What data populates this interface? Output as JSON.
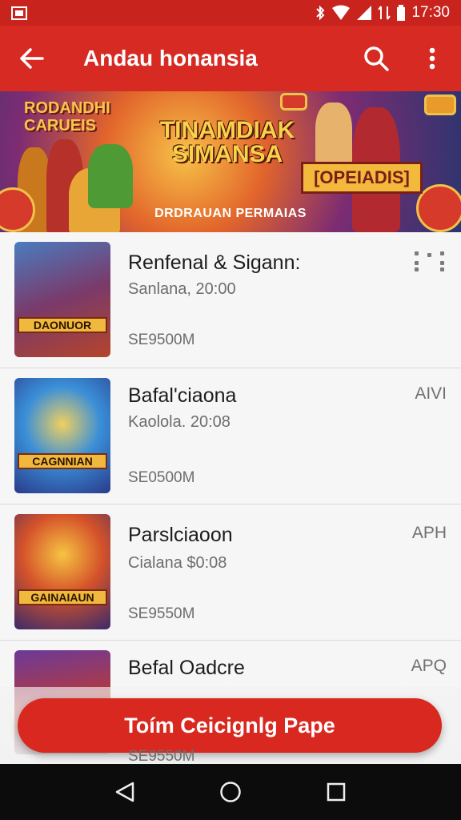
{
  "status_bar": {
    "time": "17:30",
    "icons": [
      "notification-icon",
      "bluetooth-icon",
      "wifi-icon",
      "signal-icon",
      "data-icon",
      "battery-icon"
    ]
  },
  "app_bar": {
    "title": "Andau honansia",
    "icons": [
      "arrow-back-icon",
      "search-icon",
      "more-vert-icon"
    ]
  },
  "banner": {
    "left_text": "RODANDHI CARUEIS",
    "title_line1": "TINAMDIAK",
    "title_line2": "SIMANSA",
    "right_text": "[OPEIADIS]",
    "subtitle": "DRDRAUAN PERMAIAS"
  },
  "items": [
    {
      "title": "Renfenal & Sigann:",
      "subtitle": "Sanlana, 20:00",
      "size": "SE9500M",
      "tag": "",
      "thumb_caption": "DAONUOR"
    },
    {
      "title": "Bafal'ciaona",
      "subtitle": "Kaolola. 20:08",
      "size": "SE0500M",
      "tag": "AIVI",
      "thumb_caption": "CAGNNIAN"
    },
    {
      "title": "Parslciaoon",
      "subtitle": "Cialana $0:08",
      "size": "SE9550M",
      "tag": "APH",
      "thumb_caption": "GAINAIAUN"
    },
    {
      "title": "Befal Oadcre",
      "subtitle": "",
      "size": "SE9550M",
      "tag": "APQ",
      "thumb_caption": ""
    }
  ],
  "cta": {
    "label": "Toím Ceicignlg Pape"
  },
  "nav_bar": {
    "icons": [
      "back-triangle-icon",
      "home-circle-icon",
      "recents-square-icon"
    ]
  },
  "colors": {
    "primary": "#d62a22",
    "status": "#c8231d",
    "background": "#f2f2f2",
    "nav": "#0c0c0c"
  }
}
